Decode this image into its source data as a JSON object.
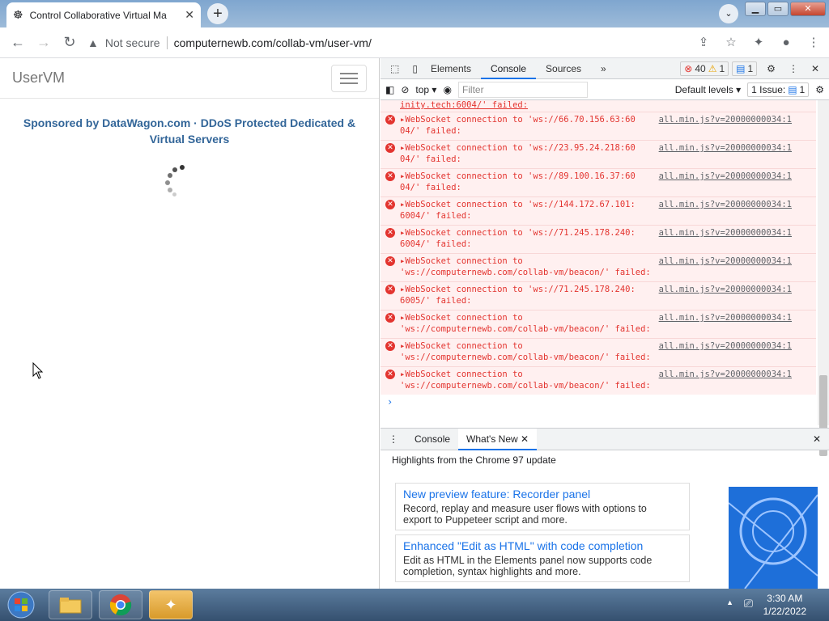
{
  "browser": {
    "tab_title": "Control Collaborative Virtual Ma",
    "address_warning": "Not secure",
    "url": "computernewb.com/collab-vm/user-vm/"
  },
  "page": {
    "brand": "UserVM",
    "sponsor_line1": "Sponsored by DataWagon.com · DDoS Protected Dedicated &",
    "sponsor_line2": "Virtual Servers"
  },
  "devtools": {
    "tabs": [
      "Elements",
      "Console",
      "Sources"
    ],
    "more_tabs": "»",
    "error_count": "40",
    "warning_count": "1",
    "message_count": "1",
    "context": "top",
    "filter_placeholder": "Filter",
    "levels": "Default levels",
    "issues": "1 Issue:",
    "issues_count": "1",
    "top_truncated": "inity.tech:6004/' failed:",
    "messages": [
      {
        "l1": "WebSocket connection to 'ws://66.70.156.63:60",
        "l2": "04/' failed:",
        "src": "all.min.js?v=20000000034:1"
      },
      {
        "l1": "WebSocket connection to 'ws://23.95.24.218:60",
        "l2": "04/' failed:",
        "src": "all.min.js?v=20000000034:1"
      },
      {
        "l1": "WebSocket connection to 'ws://89.100.16.37:60",
        "l2": "04/' failed:",
        "src": "all.min.js?v=20000000034:1"
      },
      {
        "l1": "WebSocket connection to 'ws://144.172.67.101:",
        "l2": "6004/' failed:",
        "src": "all.min.js?v=20000000034:1"
      },
      {
        "l1": "WebSocket connection to 'ws://71.245.178.240:",
        "l2": "6004/' failed:",
        "src": "all.min.js?v=20000000034:1"
      },
      {
        "l1": "WebSocket connection to",
        "l2": "'ws://computernewb.com/collab-vm/beacon/' failed:",
        "src": "all.min.js?v=20000000034:1"
      },
      {
        "l1": "WebSocket connection to 'ws://71.245.178.240:",
        "l2": "6005/' failed:",
        "src": "all.min.js?v=20000000034:1"
      },
      {
        "l1": "WebSocket connection to",
        "l2": "'ws://computernewb.com/collab-vm/beacon/' failed:",
        "src": "all.min.js?v=20000000034:1"
      },
      {
        "l1": "WebSocket connection to",
        "l2": "'ws://computernewb.com/collab-vm/beacon/' failed:",
        "src": "all.min.js?v=20000000034:1"
      },
      {
        "l1": "WebSocket connection to",
        "l2": "'ws://computernewb.com/collab-vm/beacon/' failed:",
        "src": "all.min.js?v=20000000034:1"
      }
    ],
    "prompt": "›",
    "drawer_tabs": [
      "Console",
      "What's New"
    ],
    "highlights": "Highlights from the Chrome 97 update",
    "cards": [
      {
        "title": "New preview feature: Recorder panel",
        "desc1": "Record, replay and measure user flows with options to",
        "desc2": "export to Puppeteer script and more."
      },
      {
        "title": "Enhanced \"Edit as HTML\" with code completion",
        "desc1": "Edit as HTML in the Elements panel now supports code",
        "desc2": "completion, syntax highlights and more."
      }
    ]
  },
  "taskbar": {
    "time": "3:30 AM",
    "date": "1/22/2022"
  }
}
